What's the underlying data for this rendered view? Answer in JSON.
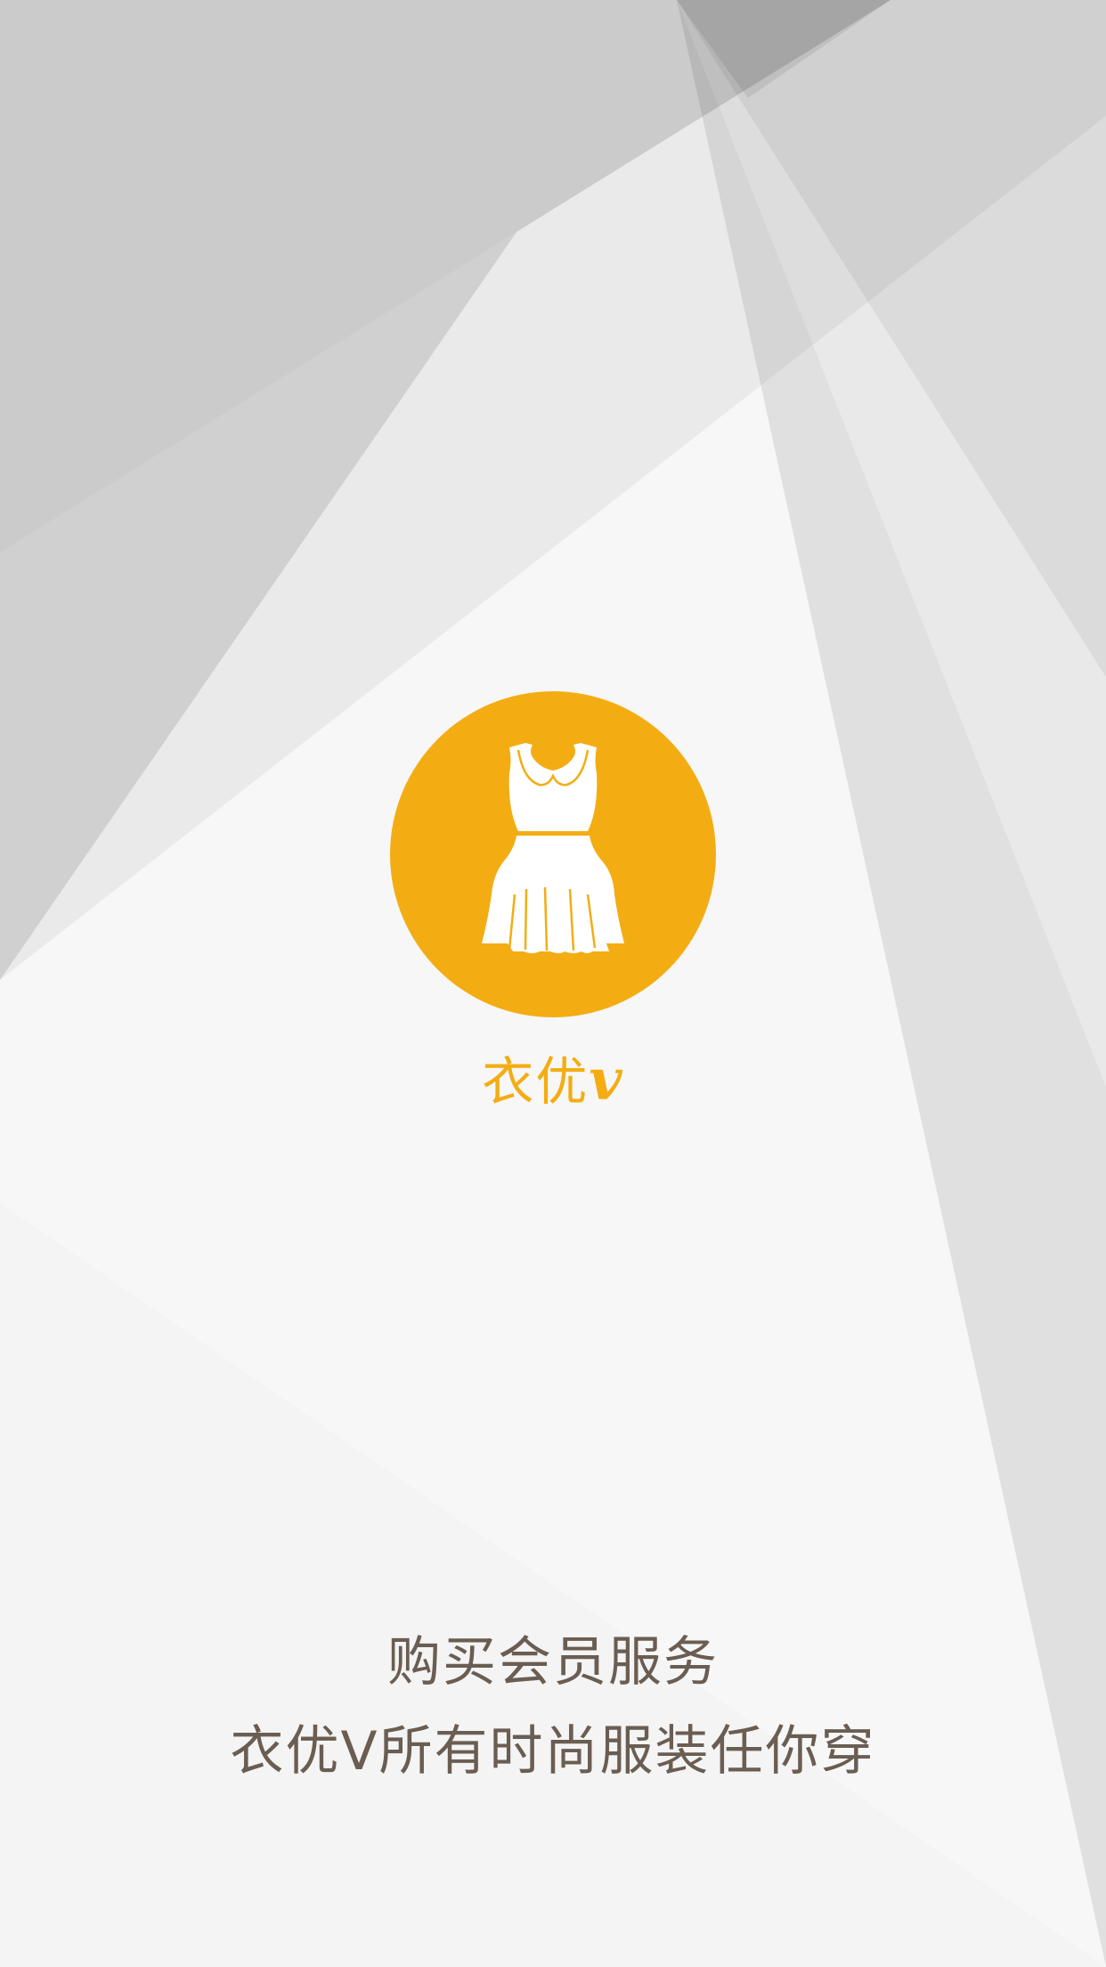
{
  "colors": {
    "accent": "#f3ad13",
    "text": "#6a5d52",
    "background": "#f7f7f7"
  },
  "logo": {
    "icon": "dress-icon"
  },
  "brand": {
    "name_cn": "衣优",
    "name_v": "v"
  },
  "tagline": {
    "line1": "购买会员服务",
    "line2": "衣优V所有时尚服装任你穿"
  }
}
